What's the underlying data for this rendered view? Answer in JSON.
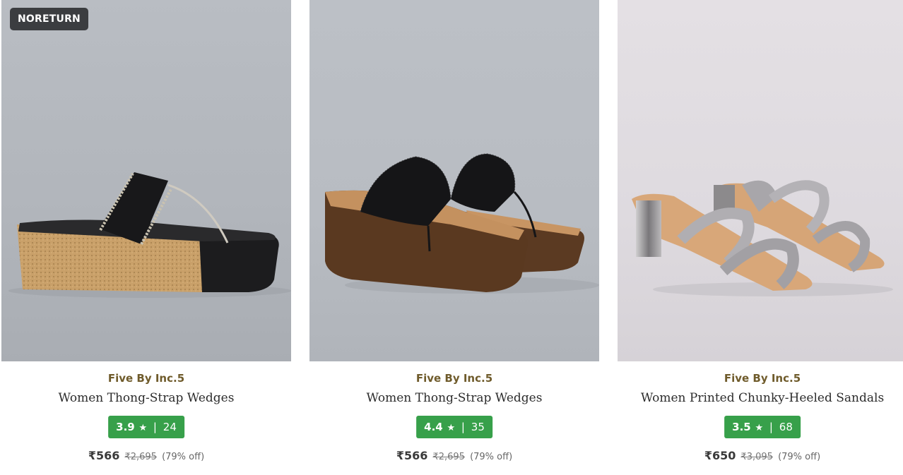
{
  "products": [
    {
      "badge": "NORETURN",
      "brand": "Five By Inc.5",
      "name": "Women Thong-Strap Wedges",
      "rating": "3.9",
      "reviews": "24",
      "price": "₹566",
      "mrp": "₹2,695",
      "discount": "(79% off)"
    },
    {
      "brand": "Five By Inc.5",
      "name": "Women Thong-Strap Wedges",
      "rating": "4.4",
      "reviews": "35",
      "price": "₹566",
      "mrp": "₹2,695",
      "discount": "(79% off)"
    },
    {
      "brand": "Five By Inc.5",
      "name": "Women Printed Chunky-Heeled Sandals",
      "rating": "3.5",
      "reviews": "68",
      "price": "₹650",
      "mrp": "₹3,095",
      "discount": "(79% off)"
    }
  ],
  "ui": {
    "star": "★",
    "separator": "|"
  },
  "colors": {
    "brand_text": "#6f5b2b",
    "rating_badge": "#37a04a",
    "noreturn_badge": "#3b3d40"
  },
  "icons": [
    "star-icon"
  ]
}
